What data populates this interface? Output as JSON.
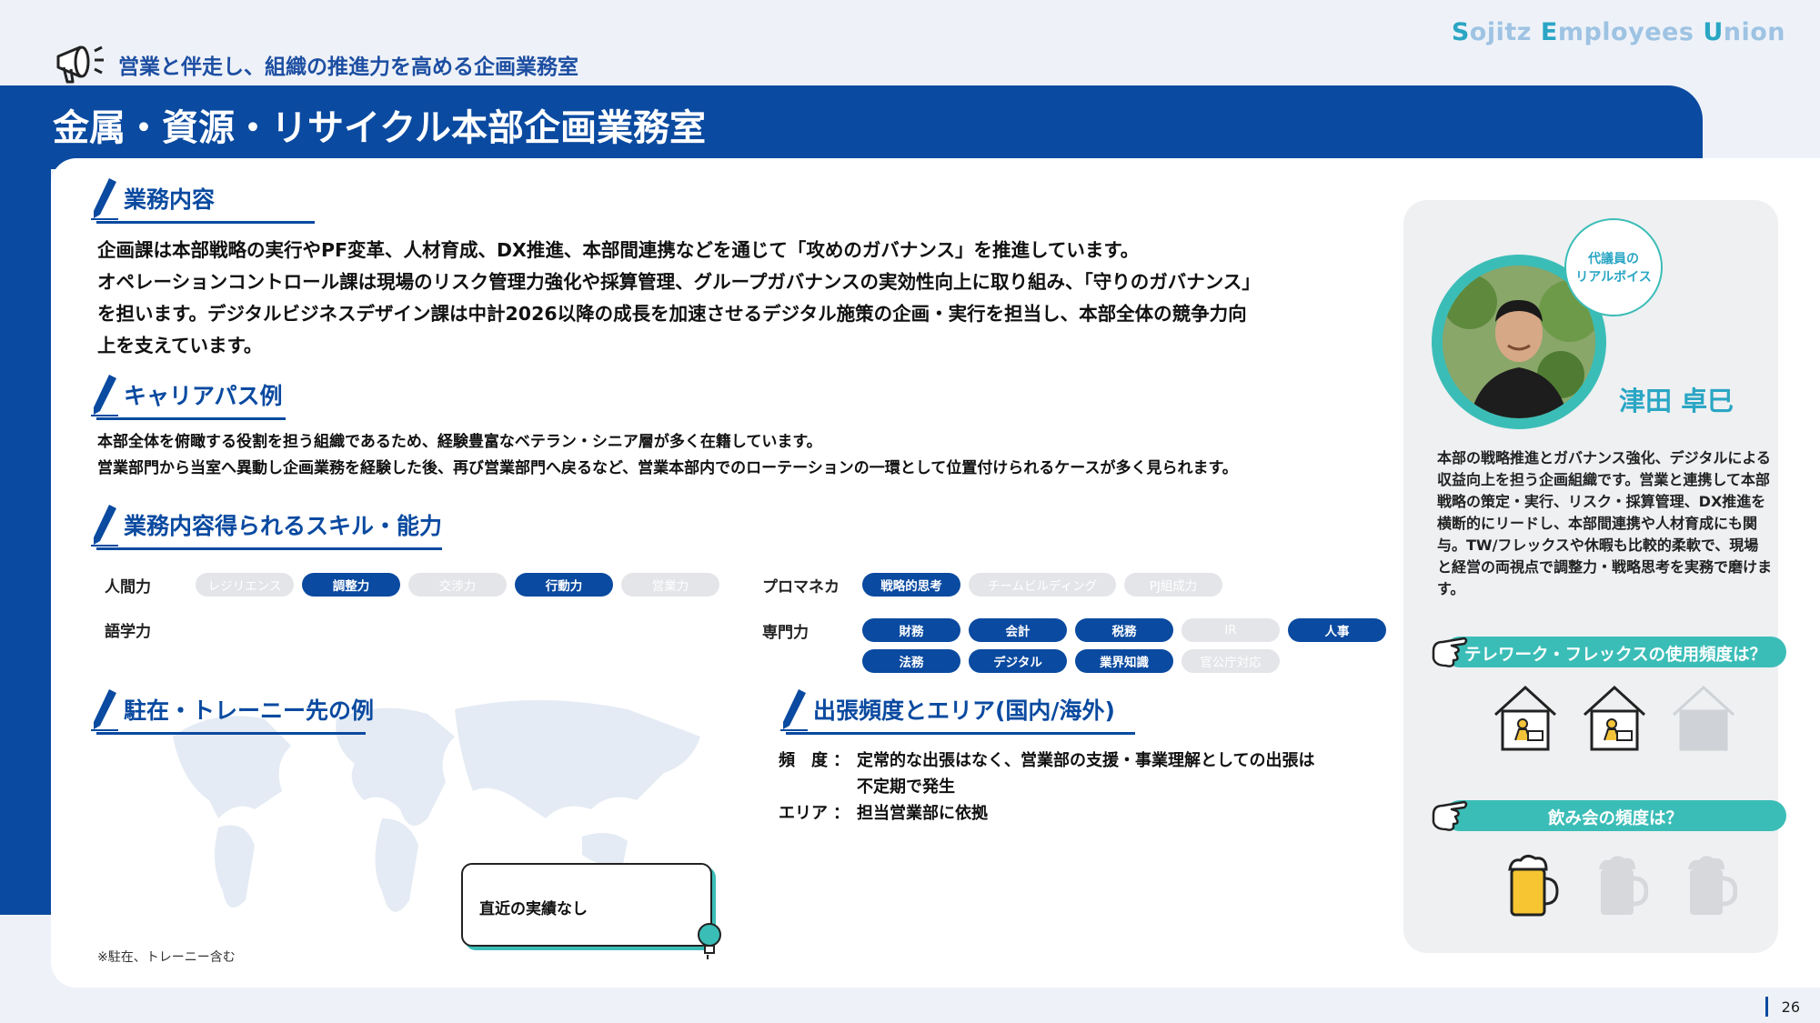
{
  "header": {
    "category": "営業と伴走し、組織の推進力を高める企画業務室",
    "brand_parts": [
      "S",
      "ojitz ",
      "E",
      "mployees ",
      "U",
      "nion"
    ],
    "title": "金属・資源・リサイクル本部企画業務室"
  },
  "sections": {
    "work": {
      "title": "業務内容",
      "lines": [
        "企画課は本部戦略の実行やPF変革、人材育成、DX推進、本部間連携などを通じて「攻めのガバナンス」を推進しています。",
        "オペレーションコントロール課は現場のリスク管理力強化や採算管理、グループガバナンスの実効性向上に取り組み、「守りのガバナンス」",
        "を担います。デジタルビジネスデザイン課は中計2026以降の成長を加速させるデジタル施策の企画・実行を担当し、本部全体の競争力向",
        "上を支えています。"
      ]
    },
    "career": {
      "title": "キャリアパス例",
      "lines": [
        "本部全体を俯瞰する役割を担う組織であるため、経験豊富なベテラン・シニア層が多く在籍しています。",
        "営業部門から当室へ異動し企画業務を経験した後、再び営業部門へ戻るなど、営業本部内でのローテーションの一環として位置付けられるケースが多く見られます。"
      ]
    },
    "skills": {
      "title": "業務内容得られるスキル・能力",
      "ningen": {
        "label": "人間力",
        "items": [
          {
            "name": "レジリエンス",
            "on": false
          },
          {
            "name": "調整力",
            "on": true
          },
          {
            "name": "交渉力",
            "on": false
          },
          {
            "name": "行動力",
            "on": true
          },
          {
            "name": "営業力",
            "on": false
          }
        ]
      },
      "gogaku": {
        "label": "語学力"
      },
      "promaneka": {
        "label": "プロマネカ",
        "items": [
          {
            "name": "戦略的思考",
            "on": true
          },
          {
            "name": "チームビルディング",
            "on": false
          },
          {
            "name": "PJ組成力",
            "on": false
          }
        ]
      },
      "senmon": {
        "label": "専門力",
        "row1": [
          {
            "name": "財務",
            "on": true
          },
          {
            "name": "会計",
            "on": true
          },
          {
            "name": "税務",
            "on": true
          },
          {
            "name": "IR",
            "on": false
          },
          {
            "name": "人事",
            "on": true
          }
        ],
        "row2": [
          {
            "name": "法務",
            "on": true
          },
          {
            "name": "デジタル",
            "on": true
          },
          {
            "name": "業界知識",
            "on": true
          },
          {
            "name": "官公庁対応",
            "on": false
          }
        ]
      }
    },
    "overseas": {
      "title": "駐在・トレーニー先の例",
      "callout": "直近の実績なし",
      "note": "※駐在、トレーニー含む"
    },
    "trip": {
      "title": "出張頻度とエリア(国内/海外)",
      "freq_key": "頻　度",
      "freq_val1": "定常的な出張はなく、営業部の支援・事業理解としての出張は",
      "freq_val2": "不定期で発生",
      "area_key": "エリア",
      "area_val": "担当営業部に依拠",
      "colon": "："
    }
  },
  "voice": {
    "bubble1": "代議員の",
    "bubble2": "リアルボイス",
    "name": "津田 卓巳",
    "desc": "本部の戦略推進とガバナンス強化、デジタルによる収益向上を担う企画組織です。営業と連携して本部戦略の策定・実行、リスク・採算管理、DX推進を横断的にリードし、本部間連携や人材育成にも関与。TW/フレックスや休暇も比較的柔軟で、現場と経営の両視点で調整力・戦略思考を実務で磨けます。",
    "q1": "テレワーク・フレックスの使用頻度は？",
    "q1_level": 2,
    "q1_max": 3,
    "q2": "飲み会の頻度は？",
    "q2_level": 1,
    "q2_max": 3
  },
  "page": {
    "number": "26"
  },
  "colors": {
    "primary": "#0a4aa0",
    "teal": "#3bbdb7",
    "off": "#e3e5e8"
  }
}
